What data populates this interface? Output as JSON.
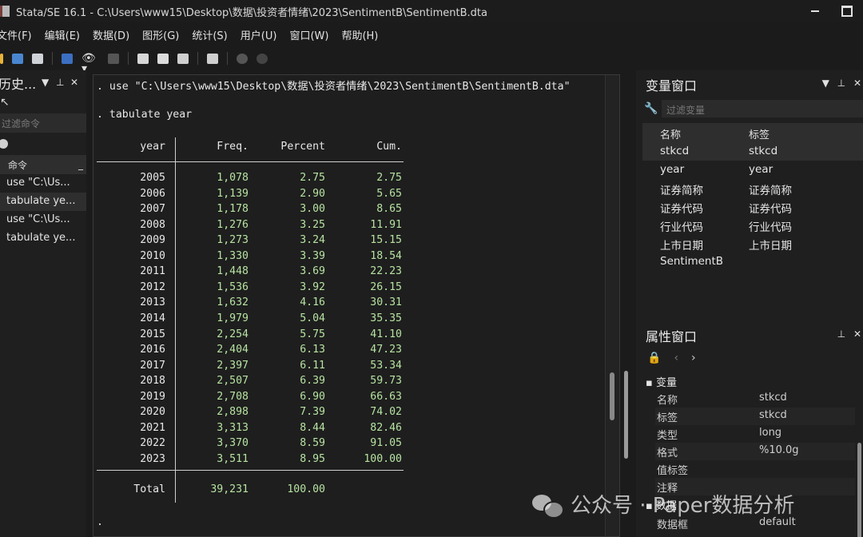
{
  "window": {
    "title": "Stata/SE 16.1 - C:\\Users\\www15\\Desktop\\数据\\投资者情绪\\2023\\SentimentB\\SentimentB.dta"
  },
  "menu": [
    "文件(F)",
    "编辑(E)",
    "数据(D)",
    "图形(G)",
    "统计(S)",
    "用户(U)",
    "窗口(W)",
    "帮助(H)"
  ],
  "history": {
    "title": "历史...",
    "filter_placeholder": "过滤命令",
    "column": "命令",
    "items": [
      "use \"C:\\Us...",
      "tabulate ye...",
      "use \"C:\\Us...",
      "tabulate ye..."
    ]
  },
  "results": {
    "cmd_use": ". use \"C:\\Users\\www15\\Desktop\\数据\\投资者情绪\\2023\\SentimentB\\SentimentB.dta\"",
    "cmd_tab": ". tabulate year",
    "prompt": ".",
    "table": {
      "headers": [
        "year",
        "Freq.",
        "Percent",
        "Cum."
      ],
      "rows": [
        [
          "2005",
          "1,078",
          "2.75",
          "2.75"
        ],
        [
          "2006",
          "1,139",
          "2.90",
          "5.65"
        ],
        [
          "2007",
          "1,178",
          "3.00",
          "8.65"
        ],
        [
          "2008",
          "1,276",
          "3.25",
          "11.91"
        ],
        [
          "2009",
          "1,273",
          "3.24",
          "15.15"
        ],
        [
          "2010",
          "1,330",
          "3.39",
          "18.54"
        ],
        [
          "2011",
          "1,448",
          "3.69",
          "22.23"
        ],
        [
          "2012",
          "1,536",
          "3.92",
          "26.15"
        ],
        [
          "2013",
          "1,632",
          "4.16",
          "30.31"
        ],
        [
          "2014",
          "1,979",
          "5.04",
          "35.35"
        ],
        [
          "2015",
          "2,254",
          "5.75",
          "41.10"
        ],
        [
          "2016",
          "2,404",
          "6.13",
          "47.23"
        ],
        [
          "2017",
          "2,397",
          "6.11",
          "53.34"
        ],
        [
          "2018",
          "2,507",
          "6.39",
          "59.73"
        ],
        [
          "2019",
          "2,708",
          "6.90",
          "66.63"
        ],
        [
          "2020",
          "2,898",
          "7.39",
          "74.02"
        ],
        [
          "2021",
          "3,313",
          "8.44",
          "82.46"
        ],
        [
          "2022",
          "3,370",
          "8.59",
          "91.05"
        ],
        [
          "2023",
          "3,511",
          "8.95",
          "100.00"
        ]
      ],
      "total": [
        "Total",
        "39,231",
        "100.00"
      ]
    }
  },
  "variables": {
    "title": "变量窗口",
    "filter_placeholder": "过滤变量",
    "col_name": "名称",
    "col_label": "标签",
    "rows": [
      [
        "stkcd",
        "stkcd"
      ],
      [
        "year",
        "year"
      ],
      [
        "证券简称",
        "证券简称"
      ],
      [
        "证券代码",
        "证券代码"
      ],
      [
        "行业代码",
        "行业代码"
      ],
      [
        "上市日期",
        "上市日期"
      ],
      [
        "SentimentB",
        ""
      ]
    ]
  },
  "properties": {
    "title": "属性窗口",
    "section_variable": "变量",
    "rows": [
      [
        "名称",
        "stkcd"
      ],
      [
        "标签",
        "stkcd"
      ],
      [
        "类型",
        "long"
      ],
      [
        "格式",
        "%10.0g"
      ],
      [
        "值标签",
        ""
      ],
      [
        "注释",
        ""
      ]
    ],
    "section_data": "数据",
    "data_rows": [
      [
        "数据框",
        "default"
      ]
    ]
  },
  "watermark": "公众号 · Paper数据分析"
}
